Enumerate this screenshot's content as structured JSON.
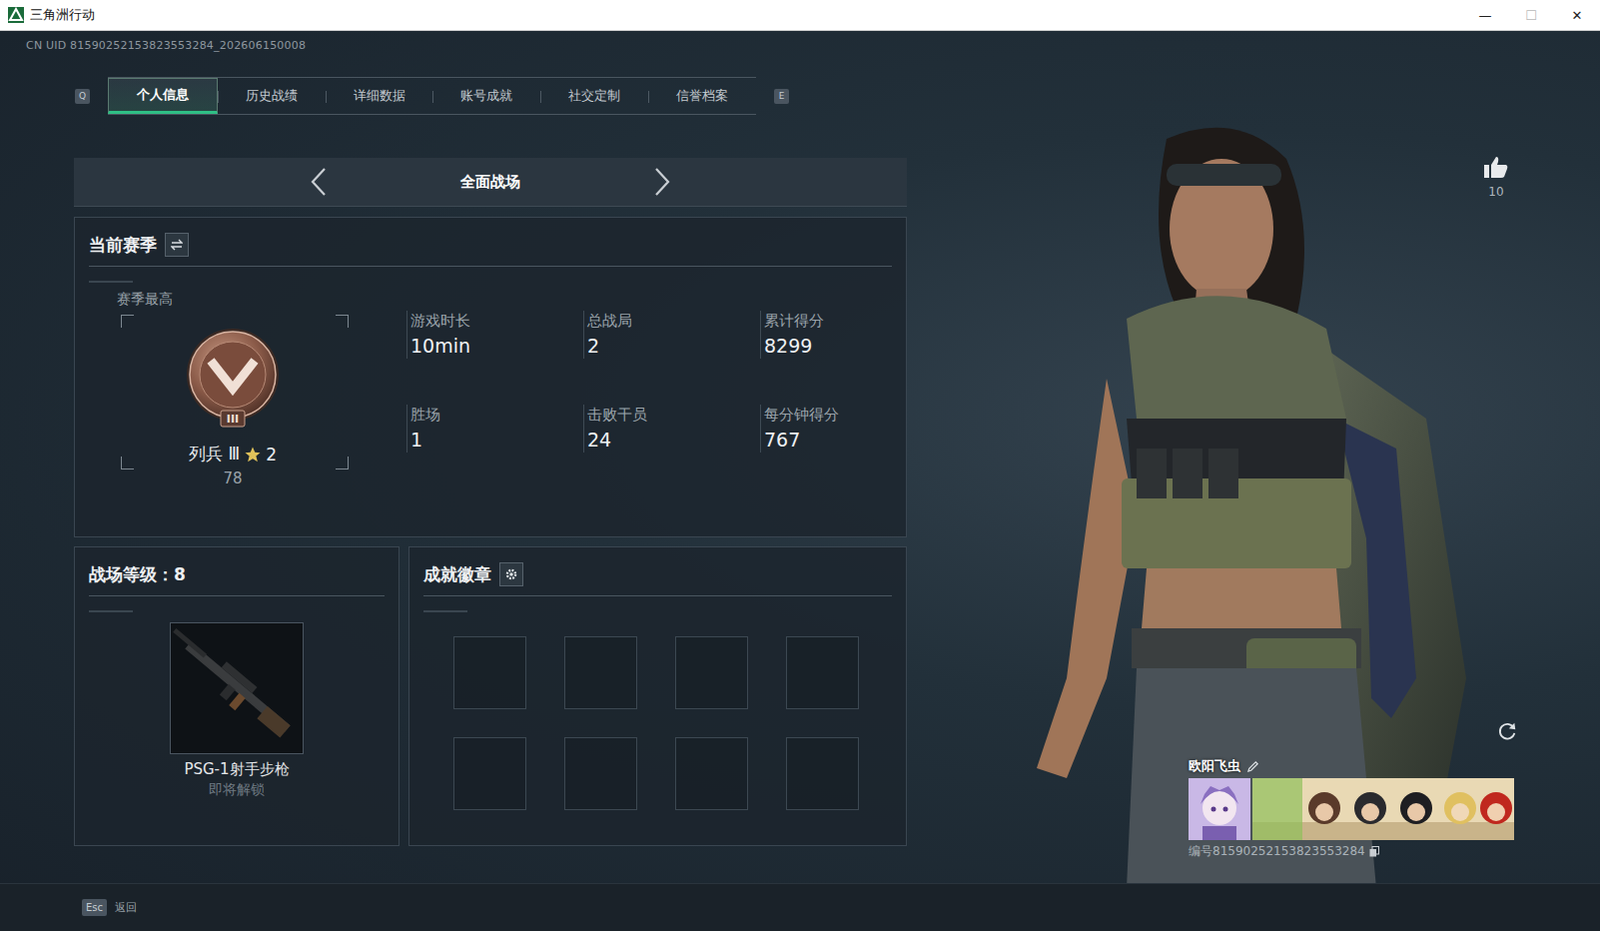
{
  "window": {
    "title": "三角洲行动",
    "controls": [
      {
        "label": "—",
        "disabled": false
      },
      {
        "label": "☐",
        "disabled": true
      },
      {
        "label": "✕",
        "disabled": false
      }
    ]
  },
  "uid": "CN UID 81590252153823553284_202606150008",
  "tabs": {
    "prev_key": "Q",
    "next_key": "E",
    "items": [
      {
        "label": "个人信息",
        "selected": true
      },
      {
        "label": "历史战绩",
        "selected": false
      },
      {
        "label": "详细数据",
        "selected": false
      },
      {
        "label": "账号成就",
        "selected": false
      },
      {
        "label": "社交定制",
        "selected": false
      },
      {
        "label": "信誉档案",
        "selected": false
      }
    ]
  },
  "mode": {
    "label": "全面战场"
  },
  "season": {
    "title": "当前赛季",
    "best_label": "赛季最高",
    "badge_text": "III",
    "rank": "列兵 Ⅲ",
    "stars": "2",
    "points": "78",
    "stats": [
      {
        "label": "游戏时长",
        "value": "10min"
      },
      {
        "label": "总战局",
        "value": "2"
      },
      {
        "label": "累计得分",
        "value": "8299"
      },
      {
        "label": "胜场",
        "value": "1"
      },
      {
        "label": "击败干员",
        "value": "24"
      },
      {
        "label": "每分钟得分",
        "value": "767"
      }
    ]
  },
  "level": {
    "label": "战场等级：",
    "value": "8",
    "reward": "PSG-1射手步枪",
    "reward_status": "即将解锁"
  },
  "achievements": {
    "title": "成就徽章",
    "slots": [
      {
        "filled": false
      },
      {
        "filled": false
      },
      {
        "filled": false
      },
      {
        "filled": false
      },
      {
        "filled": false
      },
      {
        "filled": false
      },
      {
        "filled": false
      },
      {
        "filled": false
      }
    ]
  },
  "likes": "10",
  "player": {
    "name": "欧阳飞虫",
    "id": "编号81590252153823553284"
  },
  "footer": {
    "key": "Esc",
    "label": "返回"
  }
}
